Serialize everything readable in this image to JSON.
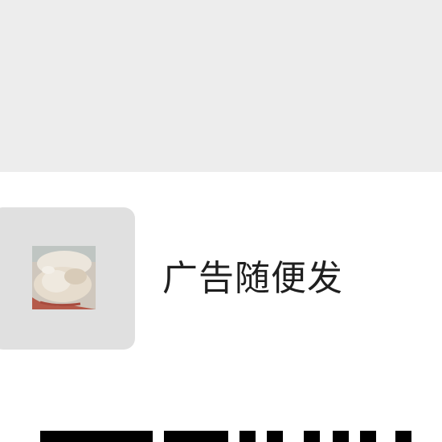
{
  "chat": {
    "item_label": "广告随便发",
    "thumbnail_icon": "bread-photo-icon"
  },
  "colors": {
    "top_background": "#ededed",
    "item_background": "#ffffff",
    "thumb_frame": "#e0e0e0",
    "text": "#1f1f1f",
    "bar": "#000000"
  }
}
